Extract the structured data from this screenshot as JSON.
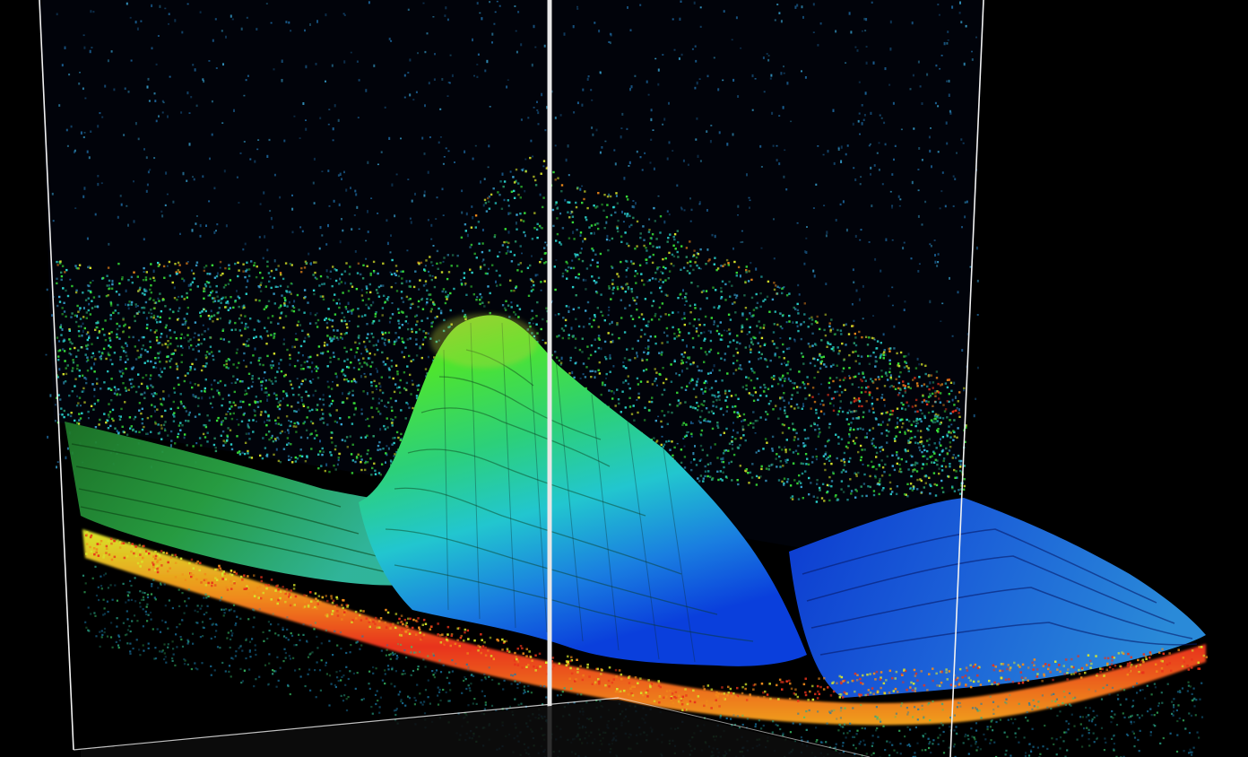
{
  "scene": {
    "subject": "oct-3d-volume-render",
    "background_color": "#000000",
    "frame_color": "#ffffff",
    "palette": {
      "deep_blue": "#0a2fd8",
      "blue": "#1f6fe0",
      "cyan": "#2ad6d0",
      "green": "#39e63a",
      "yellow": "#d8e62a",
      "orange": "#f08a1a",
      "red": "#e8321a",
      "noise": "#3aa8d8"
    }
  }
}
